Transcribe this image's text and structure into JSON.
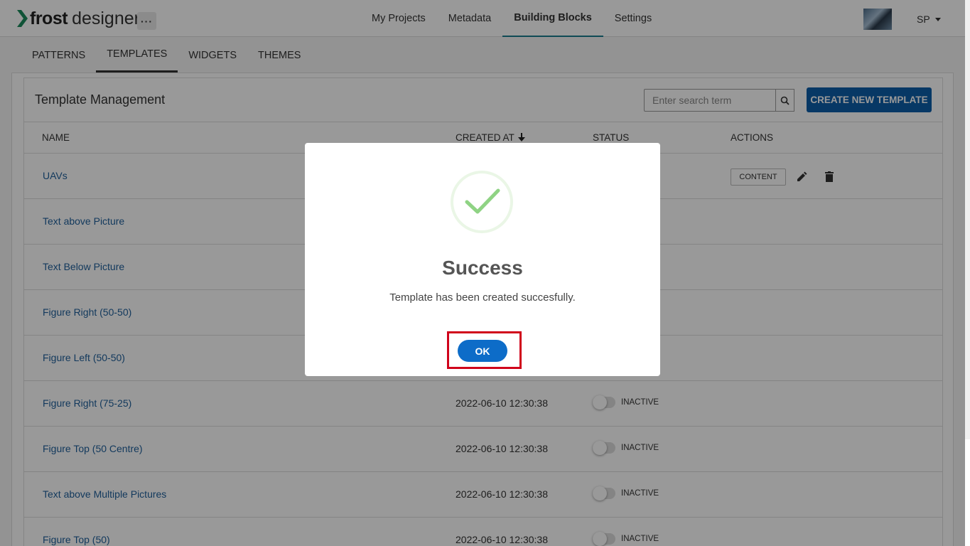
{
  "app": {
    "logo_bold": "frost",
    "logo_light": "designer",
    "more_label": "···"
  },
  "topnav": [
    {
      "label": "My Projects"
    },
    {
      "label": "Metadata"
    },
    {
      "label": "Building Blocks"
    },
    {
      "label": "Settings"
    }
  ],
  "user": {
    "initials": "SP"
  },
  "subtabs": [
    {
      "label": "PATTERNS"
    },
    {
      "label": "TEMPLATES"
    },
    {
      "label": "WIDGETS"
    },
    {
      "label": "THEMES"
    }
  ],
  "card": {
    "title": "Template Management",
    "search_placeholder": "Enter search term",
    "create_button": "CREATE NEW TEMPLATE"
  },
  "table": {
    "headers": {
      "name": "NAME",
      "created": "CREATED AT",
      "status": "STATUS",
      "actions": "ACTIONS"
    },
    "action_content_label": "CONTENT",
    "rows": [
      {
        "name": "UAVs",
        "date": "",
        "status": ""
      },
      {
        "name": "Text above Picture",
        "date": "",
        "status": ""
      },
      {
        "name": "Text Below Picture",
        "date": "",
        "status": ""
      },
      {
        "name": "Figure Right (50-50)",
        "date": "",
        "status": ""
      },
      {
        "name": "Figure Left (50-50)",
        "date": "",
        "status": ""
      },
      {
        "name": "Figure Right (75-25)",
        "date": "2022-06-10 12:30:38",
        "status": "INACTIVE"
      },
      {
        "name": "Figure Top (50 Centre)",
        "date": "2022-06-10 12:30:38",
        "status": "INACTIVE"
      },
      {
        "name": "Text above Multiple Pictures",
        "date": "2022-06-10 12:30:38",
        "status": "INACTIVE"
      },
      {
        "name": "Figure Top (50)",
        "date": "2022-06-10 12:30:38",
        "status": "INACTIVE"
      }
    ]
  },
  "modal": {
    "title": "Success",
    "message": "Template has been created succesfully.",
    "ok_label": "OK"
  },
  "colors": {
    "accent": "#0d5ea8",
    "link": "#1f5f9b",
    "success": "#8fd384",
    "highlight": "#d0021b"
  }
}
